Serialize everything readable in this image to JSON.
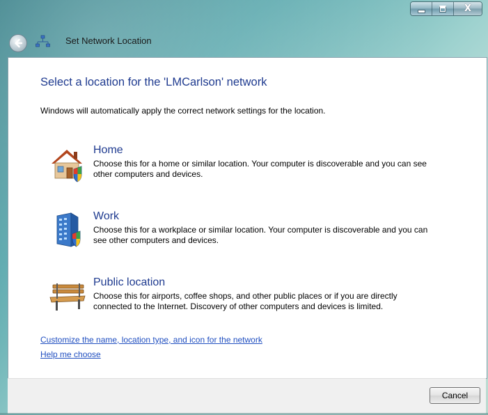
{
  "window": {
    "title": "Set Network Location",
    "caption_icons": [
      "minimize-icon",
      "maximize-icon",
      "close-icon"
    ],
    "close_glyph": "X"
  },
  "content": {
    "heading": "Select a location for the 'LMCarlson' network",
    "intro": "Windows will automatically apply the correct network settings for the location.",
    "options": [
      {
        "title": "Home",
        "description": "Choose this for a home or similar location. Your computer is discoverable and you can see other computers and devices.",
        "icon": "home-icon"
      },
      {
        "title": "Work",
        "description": "Choose this for a workplace or similar location. Your computer is discoverable and you can see other computers and devices.",
        "icon": "work-building-icon"
      },
      {
        "title": "Public location",
        "description": "Choose this for airports, coffee shops, and other public places or if you are directly connected to the Internet. Discovery of other computers and devices is limited.",
        "icon": "park-bench-icon"
      }
    ],
    "links": {
      "customize": "Customize the name, location type, and icon for the network",
      "help": "Help me choose"
    }
  },
  "footer": {
    "cancel_label": "Cancel"
  },
  "colors": {
    "heading": "#1e3a8f",
    "link": "#1f4ec0"
  }
}
